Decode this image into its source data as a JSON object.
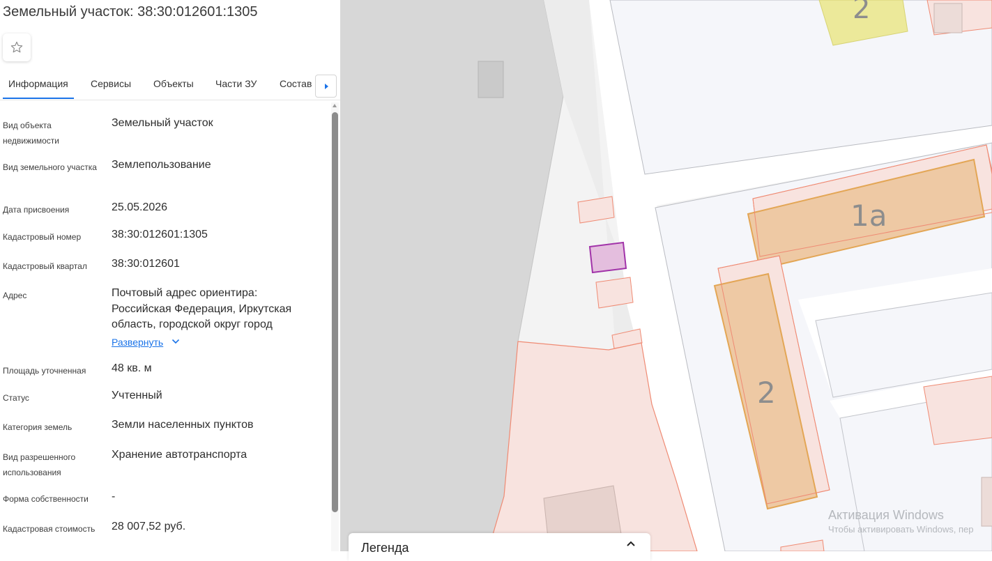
{
  "panel": {
    "title": "Земельный участок: 38:30:012601:1305",
    "tabs": [
      {
        "label": "Информация",
        "active": true
      },
      {
        "label": "Сервисы",
        "active": false
      },
      {
        "label": "Объекты",
        "active": false
      },
      {
        "label": "Части ЗУ",
        "active": false
      },
      {
        "label": "Состав",
        "active": false
      }
    ],
    "fields": [
      {
        "label": "Вид объекта недвижимости",
        "value": "Земельный участок"
      },
      {
        "label": "Вид земельного участка",
        "value": "Землепользование"
      },
      {
        "label": "Дата присвоения",
        "value": "25.05.2026"
      },
      {
        "label": "Кадастровый номер",
        "value": "38:30:012601:1305"
      },
      {
        "label": "Кадастровый квартал",
        "value": "38:30:012601"
      },
      {
        "label": "Адрес",
        "value": "Почтовый адрес ориентира: Российская Федерация, Иркутская область, городской округ город"
      },
      {
        "label": "Площадь уточненная",
        "value": "48 кв. м"
      },
      {
        "label": "Статус",
        "value": "Учтенный"
      },
      {
        "label": "Категория земель",
        "value": "Земли населенных пунктов"
      },
      {
        "label": "Вид разрешенного использования",
        "value": "Хранение автотранспорта"
      },
      {
        "label": "Форма собственности",
        "value": "-"
      },
      {
        "label": "Кадастровая стоимость",
        "value": "28 007,52 руб."
      }
    ],
    "expand_label": "Развернуть"
  },
  "map": {
    "labels": [
      "2",
      "1а",
      "2"
    ],
    "colors": {
      "building_fill": "#eec9a4",
      "building_border": "#e3a655",
      "parcel_fill": "#f8e3df",
      "parcel_border": "#ef8a73",
      "selected_fill": "#e4bede",
      "selected_border": "#a133a9",
      "highlight_fill": "#ece99a",
      "road": "#ffffff",
      "block": "#f5f6fa",
      "dark_area": "#d7d7d7"
    }
  },
  "legend": {
    "title": "Легенда"
  },
  "watermark": {
    "title": "Активация Windows",
    "subtitle": "Чтобы активировать Windows, пер"
  },
  "icons": [
    "star-icon",
    "chevron-right-icon",
    "chevron-down-icon",
    "chevron-up-icon"
  ]
}
